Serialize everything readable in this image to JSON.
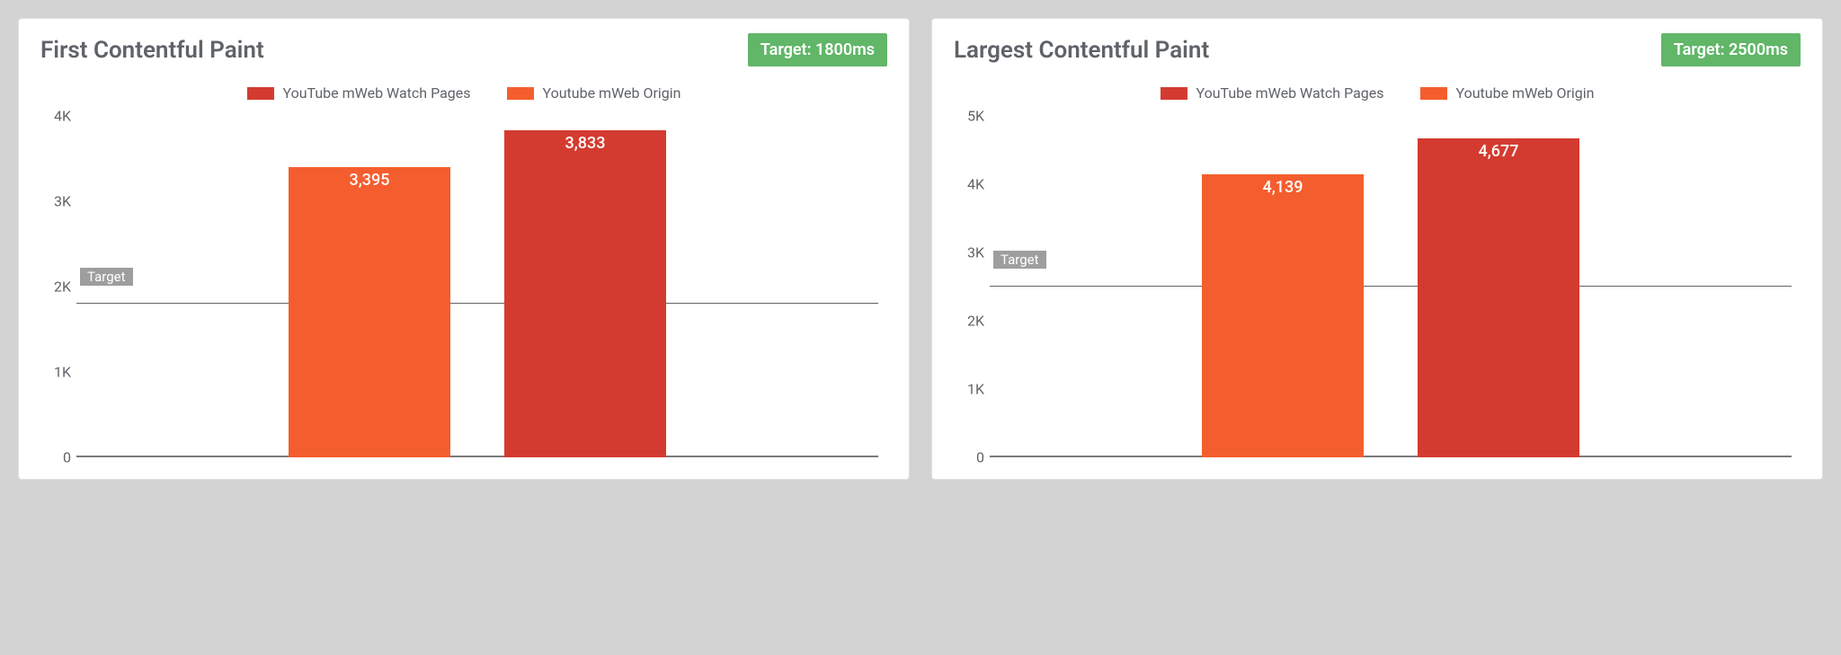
{
  "colors": {
    "orange": "#f45e2e",
    "red": "#d43b30",
    "badge": "#61b668",
    "gray": "#9e9e9e"
  },
  "target_label": "Target",
  "chart_data": [
    {
      "type": "bar",
      "title": "First Contentful Paint",
      "badge": "Target: 1800ms",
      "target": 1800,
      "ylim": [
        0,
        4000
      ],
      "ystep": 1000,
      "yticks": [
        "0",
        "1K",
        "2K",
        "3K",
        "4K"
      ],
      "series": [
        {
          "name": "YouTube mWeb Watch Pages",
          "color": "red",
          "value": 3833,
          "label": "3,833"
        },
        {
          "name": "Youtube mWeb Origin",
          "color": "orange",
          "value": 3395,
          "label": "3,395"
        }
      ],
      "bars_order": [
        "orange",
        "red"
      ]
    },
    {
      "type": "bar",
      "title": "Largest Contentful Paint",
      "badge": "Target: 2500ms",
      "target": 2500,
      "ylim": [
        0,
        5000
      ],
      "ystep": 1000,
      "yticks": [
        "0",
        "1K",
        "2K",
        "3K",
        "4K",
        "5K"
      ],
      "series": [
        {
          "name": "YouTube mWeb Watch Pages",
          "color": "red",
          "value": 4677,
          "label": "4,677"
        },
        {
          "name": "Youtube mWeb Origin",
          "color": "orange",
          "value": 4139,
          "label": "4,139"
        }
      ],
      "bars_order": [
        "orange",
        "red"
      ]
    }
  ]
}
